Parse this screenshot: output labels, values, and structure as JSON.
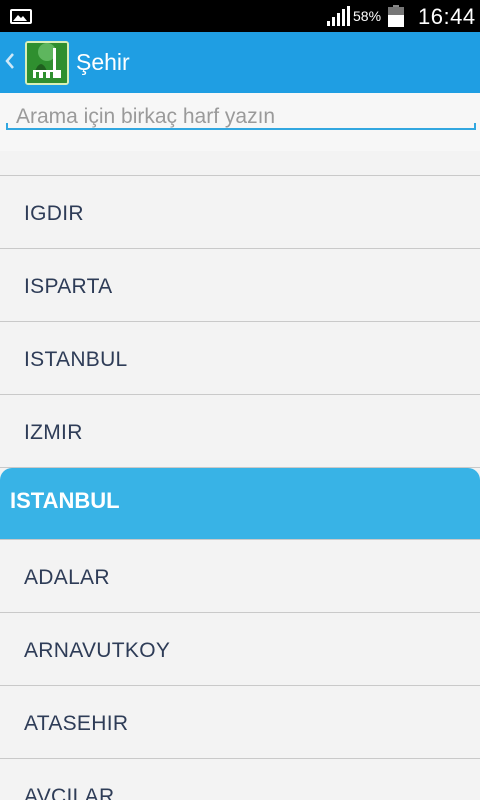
{
  "status_bar": {
    "battery_percent": "58%",
    "time": "16:44",
    "icons": [
      "gallery-icon",
      "signal-icon",
      "battery-icon"
    ]
  },
  "action_bar": {
    "title": "Şehir",
    "back_icon": "chevron-left-icon",
    "app_icon": "mosque-icon"
  },
  "search": {
    "placeholder": "Arama için birkaç harf yazın",
    "value": ""
  },
  "list": {
    "items_before": [
      "IGDIR",
      "ISPARTA",
      "ISTANBUL",
      "IZMIR"
    ],
    "section_header": "ISTANBUL",
    "items_after": [
      "ADALAR",
      "ARNAVUTKOY",
      "ATASEHIR",
      "AVCILAR"
    ]
  },
  "colors": {
    "action_bar": "#1f9ee3",
    "section_header": "#38b3e6",
    "item_text": "#2e3c57",
    "background": "#f3f3f3"
  }
}
